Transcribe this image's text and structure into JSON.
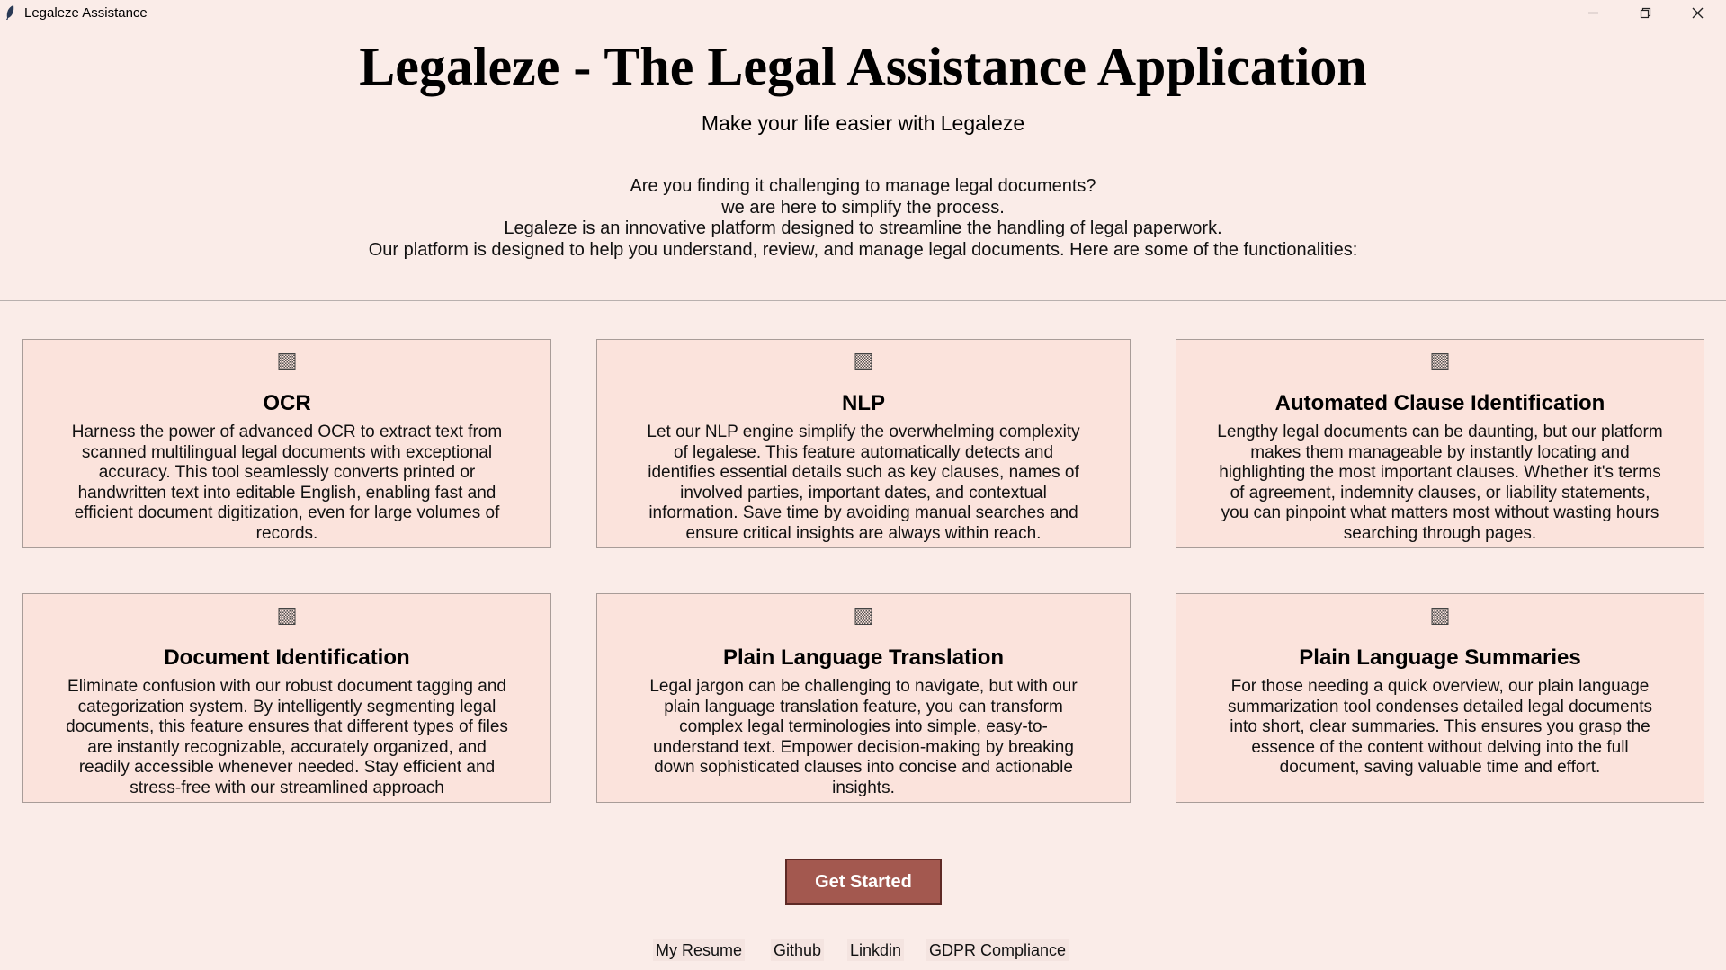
{
  "window": {
    "title": "Legaleze Assistance"
  },
  "header": {
    "title": "Legaleze - The Legal Assistance Application",
    "subtitle": "Make your life easier with Legaleze",
    "intro_lines": [
      "Are you finding it challenging to manage legal documents?",
      "we are here to simplify the process.",
      "Legaleze is an innovative platform designed to streamline the handling of legal paperwork.",
      "Our platform is designed to help you understand, review, and manage legal documents. Here are some of the functionalities:"
    ]
  },
  "features": [
    {
      "icon": "image-placeholder-icon",
      "title": "OCR",
      "description": "Harness the power of advanced OCR to extract text from scanned multilingual legal documents with exceptional accuracy. This tool seamlessly converts printed or handwritten text into editable English, enabling fast and efficient document digitization, even for large volumes of records."
    },
    {
      "icon": "image-placeholder-icon",
      "title": "NLP",
      "description": "Let our NLP engine simplify the overwhelming complexity of legalese. This feature automatically detects and identifies essential details such as key clauses, names of involved parties, important dates, and contextual information. Save time by avoiding manual searches and ensure critical insights are always within reach."
    },
    {
      "icon": "image-placeholder-icon",
      "title": "Automated Clause Identification",
      "description": "Lengthy legal documents can be daunting, but our platform makes them manageable by instantly locating and highlighting the most important clauses. Whether it's terms of agreement, indemnity clauses, or liability statements, you can pinpoint what matters most without wasting hours searching through pages."
    },
    {
      "icon": "image-placeholder-icon",
      "title": "Document Identification",
      "description": "Eliminate confusion with our robust document tagging and categorization system. By intelligently segmenting legal documents, this feature ensures that different types of files are instantly recognizable, accurately organized, and readily accessible whenever needed. Stay efficient and stress-free with our streamlined approach"
    },
    {
      "icon": "image-placeholder-icon",
      "title": "Plain Language Translation",
      "description": "Legal jargon can be challenging to navigate, but with our plain language translation feature, you can transform complex legal terminologies into simple, easy-to-understand text. Empower decision-making by breaking down sophisticated clauses into concise and actionable insights."
    },
    {
      "icon": "image-placeholder-icon",
      "title": "Plain Language Summaries",
      "description": "For those needing a quick overview, our plain language summarization tool condenses detailed legal documents into short, clear summaries. This ensures you grasp the essence of the content without delving into the full document, saving valuable time and effort."
    }
  ],
  "cta": {
    "label": "Get Started"
  },
  "footer": {
    "links": [
      "My Resume",
      "Github",
      "Linkdin",
      "GDPR Compliance"
    ]
  },
  "colors": {
    "background": "#faece8",
    "card": "#fbe3dc",
    "button": "#a3584f"
  }
}
